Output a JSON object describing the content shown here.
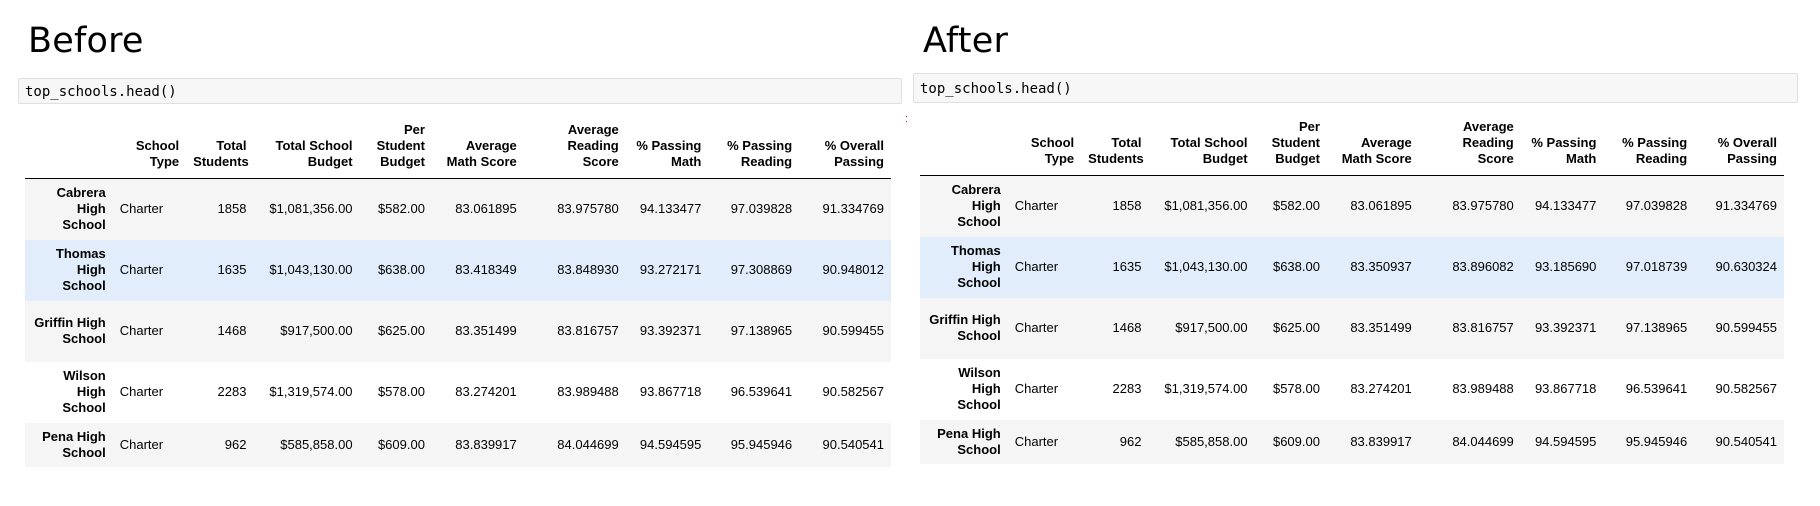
{
  "before": {
    "title": "Before",
    "code": "top_schools.head()",
    "columns": [
      "",
      "School Type",
      "Total Students",
      "Total School Budget",
      "Per Student Budget",
      "Average Math Score",
      "Average Reading Score",
      "% Passing Math",
      "% Passing Reading",
      "% Overall Passing"
    ],
    "rows": [
      {
        "name": "Cabrera High School",
        "type": "Charter",
        "students": "1858",
        "budget": "$1,081,356.00",
        "per_student": "$582.00",
        "math": "83.061895",
        "reading": "83.975780",
        "pass_math": "94.133477",
        "pass_reading": "97.039828",
        "overall": "91.334769"
      },
      {
        "name": "Thomas High School",
        "type": "Charter",
        "students": "1635",
        "budget": "$1,043,130.00",
        "per_student": "$638.00",
        "math": "83.418349",
        "reading": "83.848930",
        "pass_math": "93.272171",
        "pass_reading": "97.308869",
        "overall": "90.948012"
      },
      {
        "name": "Griffin High School",
        "type": "Charter",
        "students": "1468",
        "budget": "$917,500.00",
        "per_student": "$625.00",
        "math": "83.351499",
        "reading": "83.816757",
        "pass_math": "93.392371",
        "pass_reading": "97.138965",
        "overall": "90.599455"
      },
      {
        "name": "Wilson High School",
        "type": "Charter",
        "students": "2283",
        "budget": "$1,319,574.00",
        "per_student": "$578.00",
        "math": "83.274201",
        "reading": "83.989488",
        "pass_math": "93.867718",
        "pass_reading": "96.539641",
        "overall": "90.582567"
      },
      {
        "name": "Pena High School",
        "type": "Charter",
        "students": "962",
        "budget": "$585,858.00",
        "per_student": "$609.00",
        "math": "83.839917",
        "reading": "84.044699",
        "pass_math": "94.594595",
        "pass_reading": "95.945946",
        "overall": "90.540541"
      }
    ]
  },
  "after": {
    "title": "After",
    "code": "top_schools.head()",
    "columns": [
      "",
      "School Type",
      "Total Students",
      "Total School Budget",
      "Per Student Budget",
      "Average Math Score",
      "Average Reading Score",
      "% Passing Math",
      "% Passing Reading",
      "% Overall Passing"
    ],
    "rows": [
      {
        "name": "Cabrera High School",
        "type": "Charter",
        "students": "1858",
        "budget": "$1,081,356.00",
        "per_student": "$582.00",
        "math": "83.061895",
        "reading": "83.975780",
        "pass_math": "94.133477",
        "pass_reading": "97.039828",
        "overall": "91.334769"
      },
      {
        "name": "Thomas High School",
        "type": "Charter",
        "students": "1635",
        "budget": "$1,043,130.00",
        "per_student": "$638.00",
        "math": "83.350937",
        "reading": "83.896082",
        "pass_math": "93.185690",
        "pass_reading": "97.018739",
        "overall": "90.630324"
      },
      {
        "name": "Griffin High School",
        "type": "Charter",
        "students": "1468",
        "budget": "$917,500.00",
        "per_student": "$625.00",
        "math": "83.351499",
        "reading": "83.816757",
        "pass_math": "93.392371",
        "pass_reading": "97.138965",
        "overall": "90.599455"
      },
      {
        "name": "Wilson High School",
        "type": "Charter",
        "students": "2283",
        "budget": "$1,319,574.00",
        "per_student": "$578.00",
        "math": "83.274201",
        "reading": "83.989488",
        "pass_math": "93.867718",
        "pass_reading": "96.539641",
        "overall": "90.582567"
      },
      {
        "name": "Pena High School",
        "type": "Charter",
        "students": "962",
        "budget": "$585,858.00",
        "per_student": "$609.00",
        "math": "83.839917",
        "reading": "84.044699",
        "pass_math": "94.594595",
        "pass_reading": "95.945946",
        "overall": "90.540541"
      }
    ]
  },
  "marker": ":"
}
